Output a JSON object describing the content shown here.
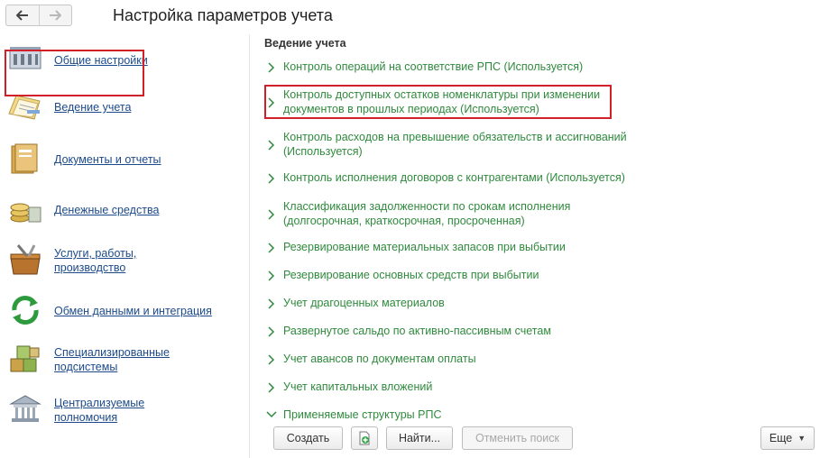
{
  "header": {
    "back_icon": "arrow-left-icon",
    "forward_icon": "arrow-right-icon",
    "title": "Настройка параметров учета"
  },
  "sidebar": {
    "items": [
      {
        "label_lines": [
          "Общие настройки"
        ],
        "icon": "building-icon"
      },
      {
        "label_lines": [
          "Ведение учета"
        ],
        "icon": "ledger-icon"
      },
      {
        "label_lines": [
          "Документы и отчеты"
        ],
        "icon": "folder-icon"
      },
      {
        "label_lines": [
          "Денежные средства"
        ],
        "icon": "coins-icon"
      },
      {
        "label_lines": [
          "Услуги, работы,",
          "производство"
        ],
        "icon": "toolbox-icon"
      },
      {
        "label_lines": [
          "Обмен данными и интеграция"
        ],
        "icon": "sync-icon"
      },
      {
        "label_lines": [
          "Специализированные",
          "подсистемы"
        ],
        "icon": "cubes-icon"
      },
      {
        "label_lines": [
          "Централизуемые",
          "полномочия"
        ],
        "icon": "institution-icon"
      }
    ]
  },
  "main": {
    "section_title": "Ведение учета",
    "rows": [
      {
        "lines": [
          "Контроль операций на соответствие РПС (Используется)"
        ],
        "expanded": false
      },
      {
        "lines": [
          "Контроль доступных остатков номенклатуры при изменении",
          "документов в прошлых периодах (Используется)"
        ],
        "expanded": false
      },
      {
        "lines": [
          "Контроль расходов на превышение обязательств и ассигнований",
          "(Используется)"
        ],
        "expanded": false
      },
      {
        "lines": [
          "Контроль исполнения договоров с контрагентами (Используется)"
        ],
        "expanded": false
      },
      {
        "lines": [
          "Классификация задолженности по срокам исполнения",
          "(долгосрочная, краткосрочная, просроченная)"
        ],
        "expanded": false
      },
      {
        "lines": [
          "Резервирование материальных запасов при выбытии"
        ],
        "expanded": false
      },
      {
        "lines": [
          "Резервирование основных средств при выбытии"
        ],
        "expanded": false
      },
      {
        "lines": [
          "Учет драгоценных материалов"
        ],
        "expanded": false
      },
      {
        "lines": [
          "Развернутое сальдо по активно-пассивным счетам"
        ],
        "expanded": false
      },
      {
        "lines": [
          "Учет авансов по документам оплаты"
        ],
        "expanded": false
      },
      {
        "lines": [
          "Учет капитальных вложений"
        ],
        "expanded": false
      },
      {
        "lines": [
          "Применяемые структуры РПС"
        ],
        "expanded": true
      }
    ]
  },
  "toolbar": {
    "create_label": "Создать",
    "copy_icon": "add-copy-icon",
    "find_label": "Найти...",
    "cancel_search_label": "Отменить поиск",
    "more_label": "Еще"
  },
  "colors": {
    "link_blue": "#1c4a8a",
    "group_green": "#2f8a3d",
    "highlight_red": "#d1202a"
  }
}
